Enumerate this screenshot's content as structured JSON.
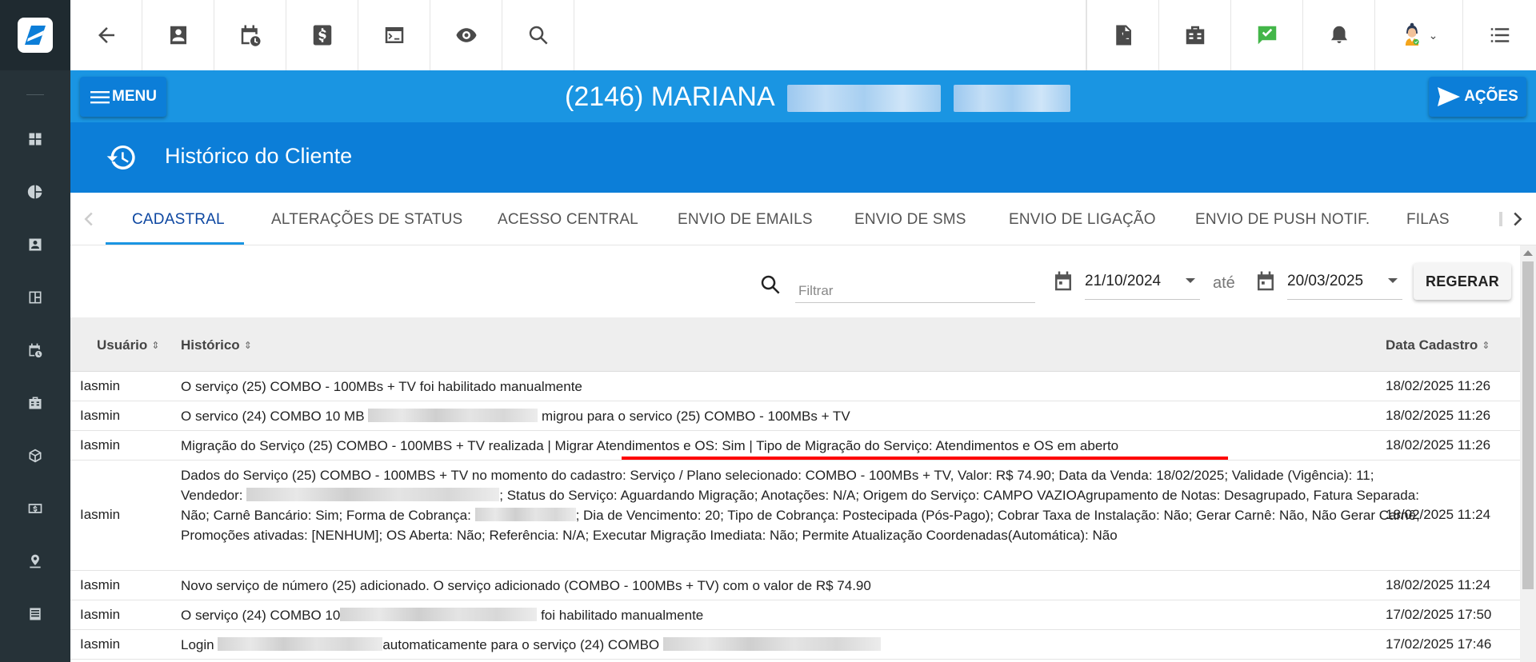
{
  "rail": {
    "items": [
      "dashboard-icon",
      "pie-chart-icon",
      "contact-card-icon",
      "board-icon",
      "calendar-clock-icon",
      "company-icon",
      "package-icon",
      "money-icon",
      "location-pin-icon",
      "list-icon"
    ]
  },
  "topbar": {
    "left_icons": [
      "back-arrow-icon",
      "person-card-icon",
      "calendar-clock-icon",
      "dollar-icon",
      "terminal-icon",
      "eye-icon",
      "search-icon"
    ],
    "right_icons": [
      "pdf-icon",
      "company-icon",
      "chat-check-icon",
      "bell-icon",
      "avatar",
      "list-menu-icon"
    ]
  },
  "header": {
    "menu_label": "MENU",
    "client_title": "(2146) MARIANA",
    "actions_label": "AÇÕES"
  },
  "section": {
    "title": "Histórico do Cliente"
  },
  "tabs": [
    {
      "label": "CADASTRAL",
      "active": true
    },
    {
      "label": "ALTERAÇÕES DE STATUS"
    },
    {
      "label": "ACESSO CENTRAL"
    },
    {
      "label": "ENVIO DE EMAILS"
    },
    {
      "label": "ENVIO DE SMS"
    },
    {
      "label": "ENVIO DE LIGAÇÃO"
    },
    {
      "label": "ENVIO DE PUSH NOTIF."
    },
    {
      "label": "FILAS"
    }
  ],
  "filter": {
    "placeholder": "Filtrar",
    "date_from": "21/10/2024",
    "until_label": "até",
    "date_to": "20/03/2025",
    "regenerate_label": "REGERAR"
  },
  "table": {
    "columns": {
      "user": "Usuário",
      "history": "Histórico",
      "date": "Data Cadastro"
    },
    "rows": [
      {
        "user": "Iasmin",
        "history_a": "O serviço (25) COMBO - 100MBs + TV foi habilitado manualmente",
        "date": "18/02/2025 11:26"
      },
      {
        "user": "Iasmin",
        "history_a": "O servico (24) COMBO 10 MB",
        "history_b": "migrou para o servico (25) COMBO - 100MBs + TV",
        "date": "18/02/2025 11:26"
      },
      {
        "user": "Iasmin",
        "history_a": "Migração do Serviço (25) COMBO - 100MBS + TV realizada | Migrar Atendimentos e OS: Sim | Tipo de Migração do Serviço: Atendimentos e OS em aberto",
        "date": "18/02/2025 11:26"
      },
      {
        "user": "Iasmin",
        "history_a": "Dados do Serviço (25) COMBO - 100MBS + TV no momento do cadastro: Serviço / Plano selecionado: COMBO - 100MBs + TV, Valor: R$ 74.90; Data da Venda: 18/02/2025; Validade (Vigência): 11; Vendedor:",
        "history_b": "; Status do Serviço: Aguardando Migração; Anotações: N/A; Origem do Serviço: CAMPO VAZIOAgrupamento de Notas: Desagrupado, Fatura Separada: Não; Carnê Bancário: Sim; Forma de Cobrança:",
        "history_c": "; Dia de Vencimento: 20; Tipo de Cobrança: Postecipada (Pós-Pago); Cobrar Taxa de Instalação: Não; Gerar Carnê: Não, Não Gerar Carnê; Promoções ativadas: [NENHUM]; OS Aberta: Não; Referência: N/A; Executar Migração Imediata: Não; Permite Atualização Coordenadas(Automática): Não",
        "date": "18/02/2025 11:24"
      },
      {
        "user": "Iasmin",
        "history_a": "Novo serviço de número (25) adicionado. O serviço adicionado (COMBO - 100MBs + TV) com o valor de R$ 74.90",
        "date": "18/02/2025 11:24"
      },
      {
        "user": "Iasmin",
        "history_a": "O serviço (24) COMBO 10",
        "history_b": "foi habilitado manualmente",
        "date": "17/02/2025 17:50"
      },
      {
        "user": "Iasmin",
        "history_a": "Login",
        "history_b": "automaticamente para o serviço (24) COMBO",
        "date": "17/02/2025 17:46"
      }
    ]
  },
  "colors": {
    "rail": "#263238",
    "header_blue": "#1a95e2",
    "section_blue": "#0c7ed8",
    "highlight_red": "#ff0000"
  }
}
